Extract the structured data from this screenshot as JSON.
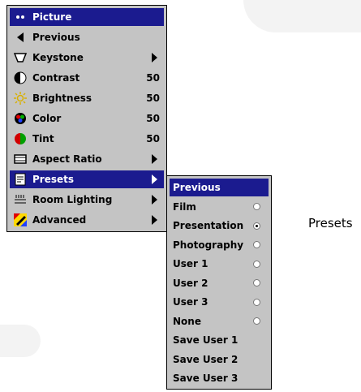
{
  "main_menu": {
    "items": [
      {
        "icon": "dots-icon",
        "label": "Picture",
        "value": "",
        "arrow": false,
        "selected": true
      },
      {
        "icon": "left-arrow-icon",
        "label": "Previous",
        "value": "",
        "arrow": false,
        "selected": false
      },
      {
        "icon": "keystone-icon",
        "label": "Keystone",
        "value": "",
        "arrow": true,
        "selected": false
      },
      {
        "icon": "contrast-icon",
        "label": "Contrast",
        "value": "50",
        "arrow": false,
        "selected": false
      },
      {
        "icon": "brightness-icon",
        "label": "Brightness",
        "value": "50",
        "arrow": false,
        "selected": false
      },
      {
        "icon": "color-icon",
        "label": "Color",
        "value": "50",
        "arrow": false,
        "selected": false
      },
      {
        "icon": "tint-icon",
        "label": "Tint",
        "value": "50",
        "arrow": false,
        "selected": false
      },
      {
        "icon": "aspect-ratio-icon",
        "label": "Aspect Ratio",
        "value": "",
        "arrow": true,
        "selected": false
      },
      {
        "icon": "presets-icon",
        "label": "Presets",
        "value": "",
        "arrow": true,
        "selected": true
      },
      {
        "icon": "room-lighting-icon",
        "label": "Room Lighting",
        "value": "",
        "arrow": true,
        "selected": false
      },
      {
        "icon": "advanced-icon",
        "label": "Advanced",
        "value": "",
        "arrow": true,
        "selected": false
      }
    ]
  },
  "presets_menu": {
    "items": [
      {
        "label": "Previous",
        "radio": false,
        "checked": false,
        "selected": true
      },
      {
        "label": "Film",
        "radio": true,
        "checked": false,
        "selected": false
      },
      {
        "label": "Presentation",
        "radio": true,
        "checked": true,
        "selected": false
      },
      {
        "label": "Photography",
        "radio": true,
        "checked": false,
        "selected": false
      },
      {
        "label": "User 1",
        "radio": true,
        "checked": false,
        "selected": false
      },
      {
        "label": "User 2",
        "radio": true,
        "checked": false,
        "selected": false
      },
      {
        "label": "User 3",
        "radio": true,
        "checked": false,
        "selected": false
      },
      {
        "label": "None",
        "radio": true,
        "checked": false,
        "selected": false
      },
      {
        "label": "Save User 1",
        "radio": false,
        "checked": false,
        "selected": false
      },
      {
        "label": "Save User 2",
        "radio": false,
        "checked": false,
        "selected": false
      },
      {
        "label": "Save User 3",
        "radio": false,
        "checked": false,
        "selected": false
      }
    ]
  },
  "caption": "Presets",
  "colors": {
    "menu_bg": "#c4c4c4",
    "highlight": "#1b1b8f"
  }
}
